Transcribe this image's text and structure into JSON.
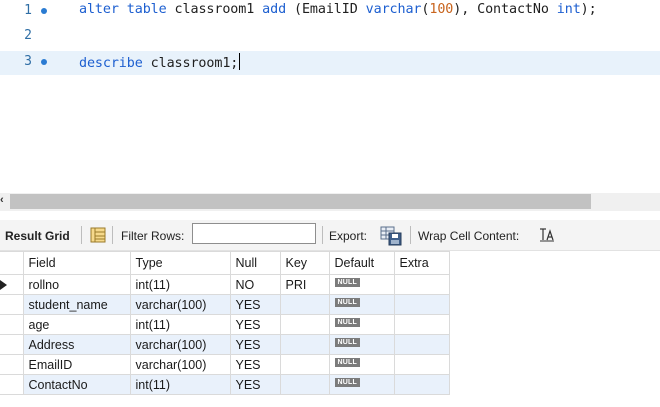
{
  "editor": {
    "lines": [
      {
        "number": "1",
        "tokens": [
          {
            "t": "alter",
            "k": "kw"
          },
          {
            "t": " "
          },
          {
            "t": "table",
            "k": "kw"
          },
          {
            "t": " classroom1 "
          },
          {
            "t": "add",
            "k": "kw"
          },
          {
            "t": " (EmailID "
          },
          {
            "t": "varchar",
            "k": "kw"
          },
          {
            "t": "("
          },
          {
            "t": "100",
            "k": "num"
          },
          {
            "t": "), ContactNo "
          },
          {
            "t": "int",
            "k": "kw"
          },
          {
            "t": ");"
          }
        ]
      },
      {
        "number": "2",
        "tokens": []
      },
      {
        "number": "3",
        "tokens": [
          {
            "t": "describe",
            "k": "kw"
          },
          {
            "t": " classroom1;"
          }
        ]
      }
    ]
  },
  "panel": {
    "result_grid_label": "Result Grid",
    "filter_rows_label": "Filter Rows:",
    "filter_rows_value": "",
    "export_label": "Export:",
    "wrap_label": "Wrap Cell Content:"
  },
  "grid": {
    "columns": [
      "Field",
      "Type",
      "Null",
      "Key",
      "Default",
      "Extra"
    ],
    "null_badge": "NULL",
    "rows": [
      [
        "rollno",
        "int(11)",
        "NO",
        "PRI",
        "NULL",
        ""
      ],
      [
        "student_name",
        "varchar(100)",
        "YES",
        "",
        "NULL",
        ""
      ],
      [
        "age",
        "int(11)",
        "YES",
        "",
        "NULL",
        ""
      ],
      [
        "Address",
        "varchar(100)",
        "YES",
        "",
        "NULL",
        ""
      ],
      [
        "EmailID",
        "varchar(100)",
        "YES",
        "",
        "NULL",
        ""
      ],
      [
        "ContactNo",
        "int(11)",
        "YES",
        "",
        "NULL",
        ""
      ]
    ]
  },
  "colors": {
    "keyword": "#1d5fd0",
    "number": "#c8641d",
    "line_number": "#2f6ea5",
    "row_alt": "#e9f1fb",
    "current_line": "#e8f2fb"
  },
  "icons": [
    "statement-dot-icon",
    "form-editor-icon",
    "export-icon",
    "wrap-text-icon",
    "row-pointer-icon"
  ]
}
